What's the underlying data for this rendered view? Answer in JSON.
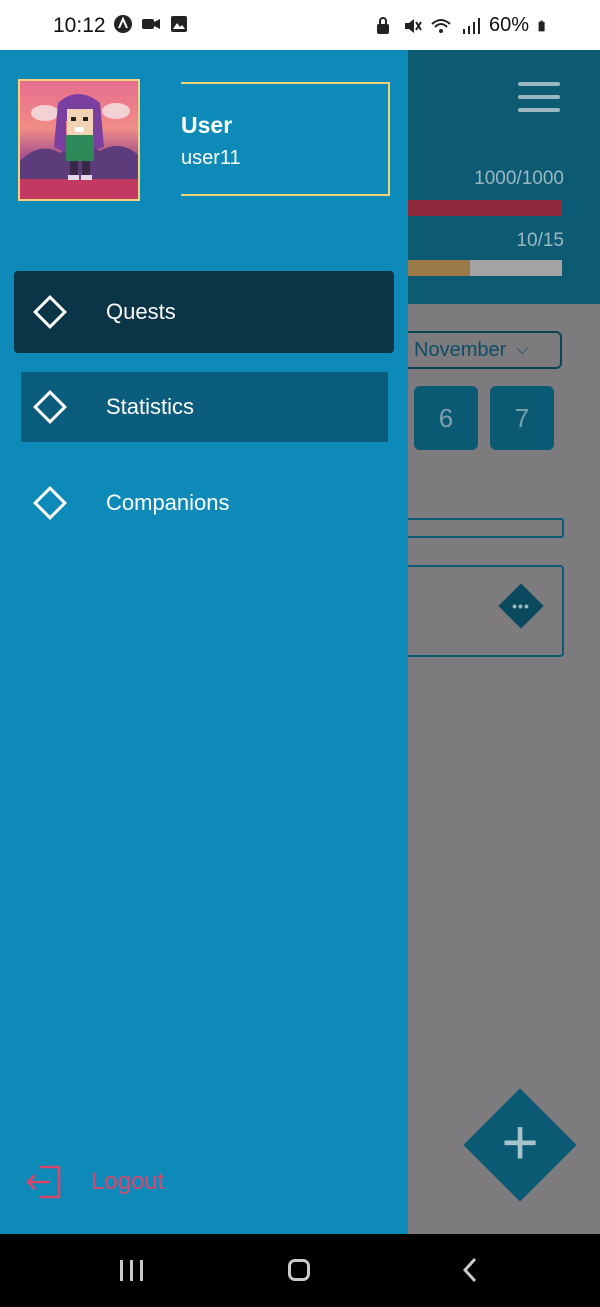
{
  "status_bar": {
    "time": "10:12",
    "battery": "60%",
    "left_icons": [
      "app-icon",
      "video-icon",
      "image-icon"
    ],
    "right_icons": [
      "lock-icon",
      "mute-icon",
      "wifi-icon",
      "signal-icon",
      "battery-icon"
    ]
  },
  "drawer": {
    "user": {
      "name": "User",
      "handle": "user11"
    },
    "menu": [
      {
        "label": "Quests",
        "icon": "diamond-icon",
        "state": "pressed"
      },
      {
        "label": "Statistics",
        "icon": "diamond-icon",
        "state": "selected"
      },
      {
        "label": "Companions",
        "icon": "diamond-icon",
        "state": "normal"
      }
    ],
    "logout_label": "Logout"
  },
  "background_app": {
    "hp_text": "1000/1000",
    "hp_fraction": 1.0,
    "xp_text": "10/15",
    "xp_fraction": 0.4,
    "month": "November",
    "days": [
      "6",
      "7"
    ],
    "fab_label": "+",
    "more_label": "•••"
  },
  "colors": {
    "drawer": "#0e8ab8",
    "menu_pressed": "#0b3547",
    "menu_selected": "#0b5d7e",
    "logout": "#d9476b",
    "avatar_border": "#f2d27c"
  }
}
